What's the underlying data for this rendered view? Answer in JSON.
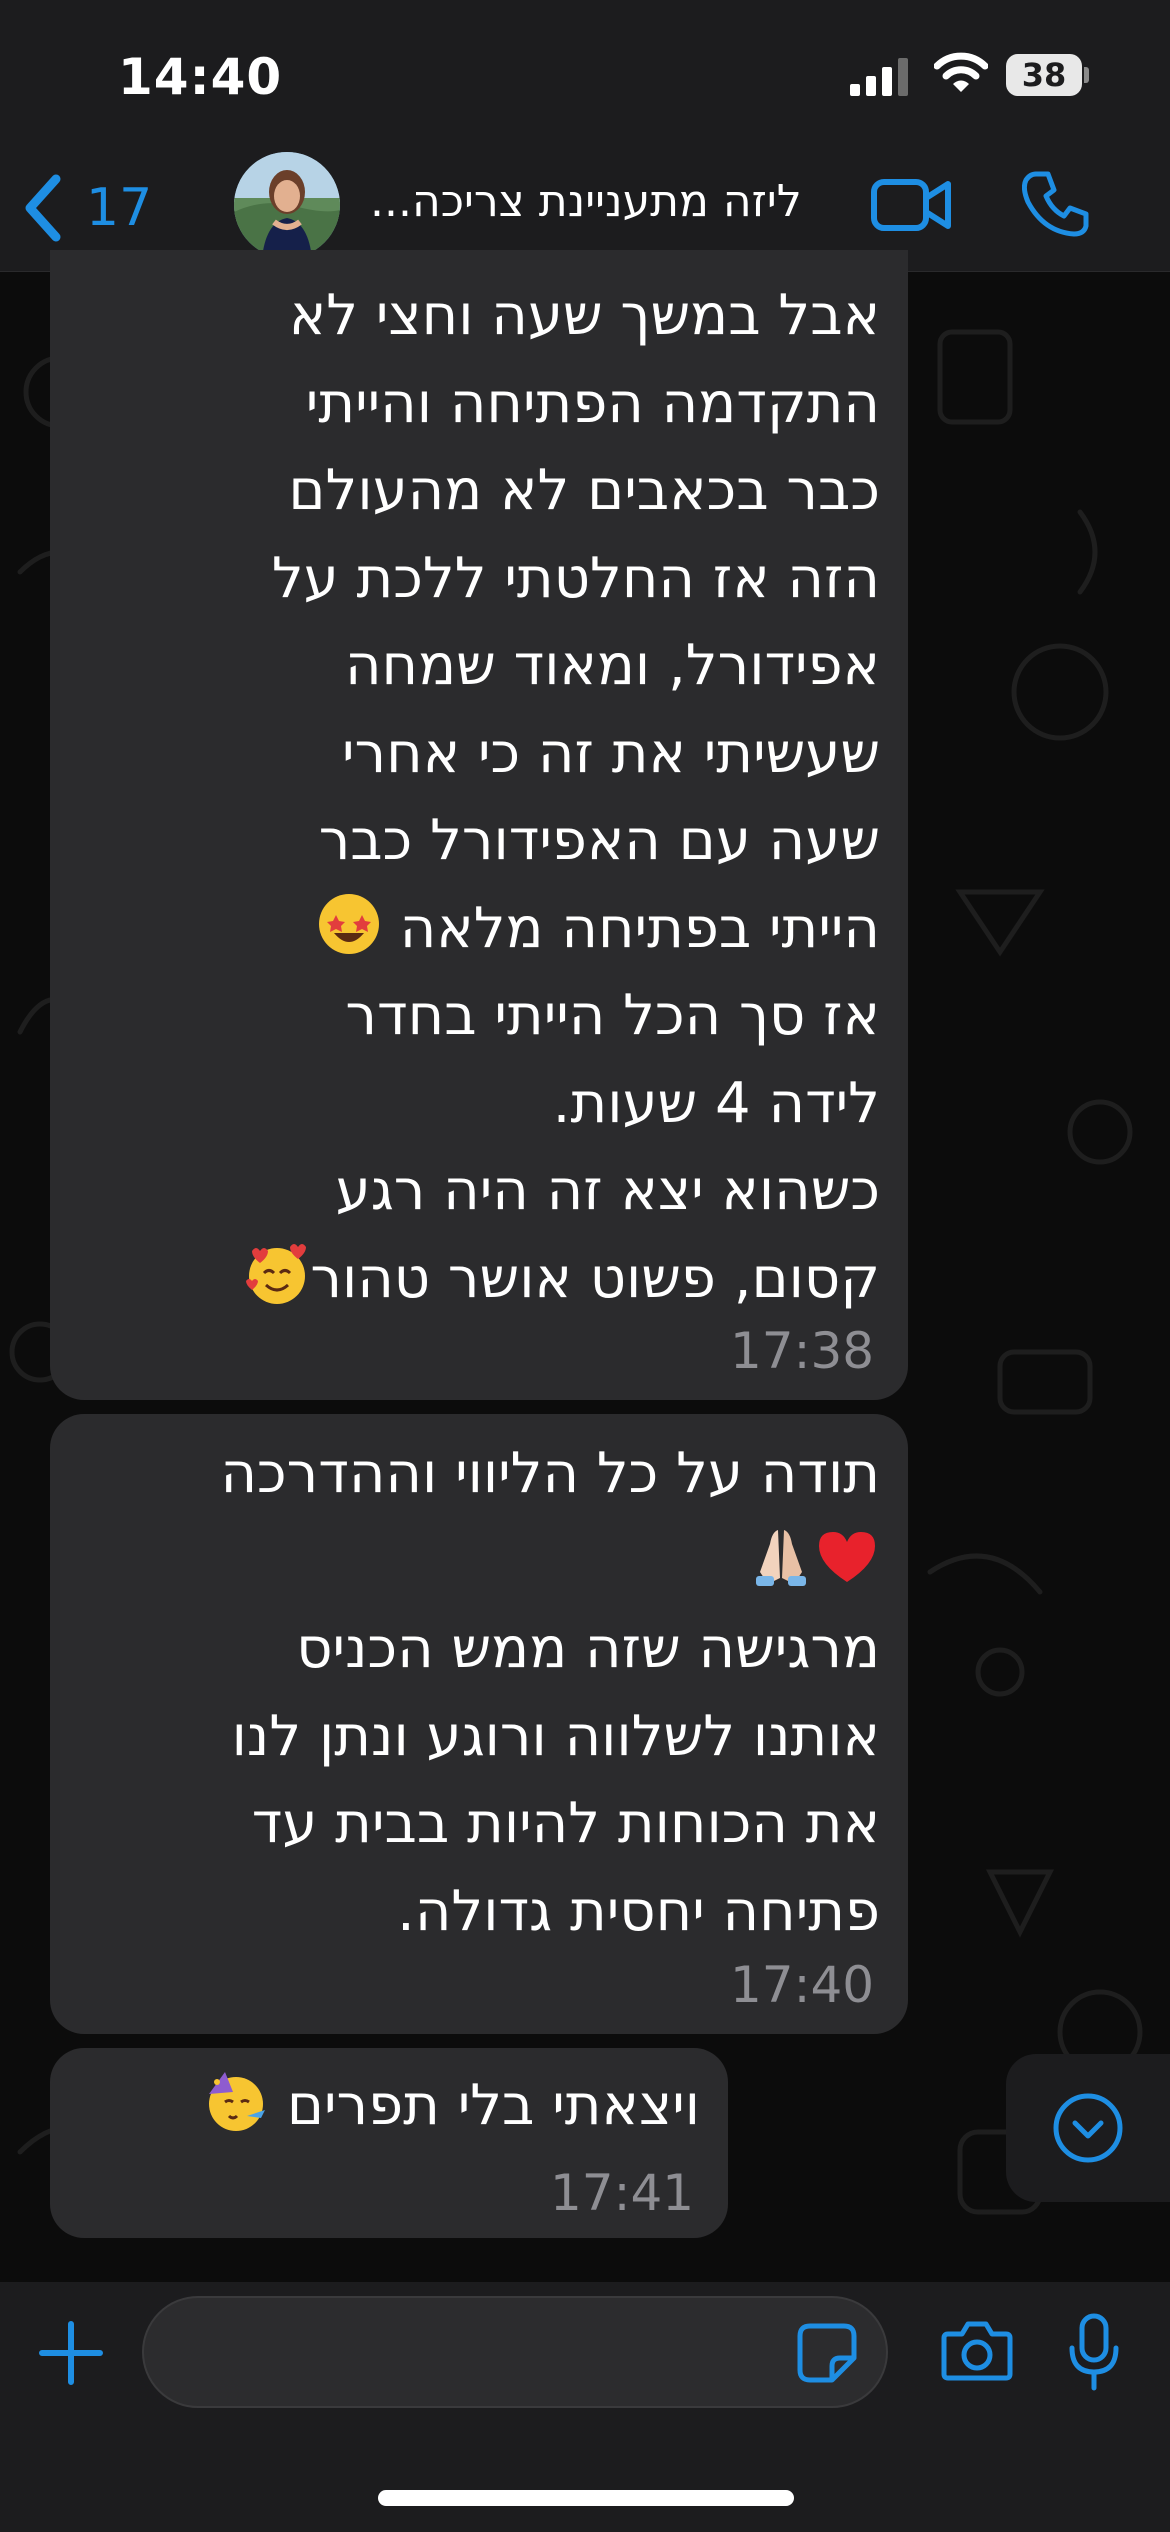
{
  "status_bar": {
    "time": "14:40",
    "battery": "38"
  },
  "header": {
    "back_count": "17",
    "contact_name": "ליזה מתעניינת צריכה...",
    "contact_name_display": "ליזה מתעניינת צריכה..."
  },
  "messages": [
    {
      "text": "אבל במשך שעה וחצי לא\nהתקדמה הפתיחה והייתי\nכבר בכאבים לא מהעולם\nהזה אז החלטתי ללכת על\nאפידורל, ומאוד שמחה\nשעשיתי את זה כי אחרי\nשעה עם האפידורל כבר\nהייתי בפתיחה מלאה",
      "text_b": "אז סך הכל הייתי בחדר\nלידה 4 שעות.\nכשהוא יצא זה היה רגע\nקסום, פשוט אושר טהור",
      "time": "17:38",
      "emojis": [
        "star-struck-emoji",
        "smiling-face-with-hearts-emoji"
      ]
    },
    {
      "text": "תודה על כל הליווי וההדרכה",
      "text_b": "מרגישה שזה ממש הכניס\nאותנו לשלווה ורוגע ונתן לנו\nאת הכוחות להיות בבית עד\nפתיחה יחסית גדולה.",
      "time": "17:40",
      "emojis": [
        "red-heart-emoji",
        "folded-hands-emoji"
      ]
    },
    {
      "text": "ויצאתי בלי תפרים",
      "time": "17:41",
      "emojis": [
        "partying-face-emoji"
      ]
    }
  ],
  "composer": {
    "placeholder": ""
  },
  "icons": [
    "signal-icon",
    "wifi-icon",
    "battery-icon",
    "back-chevron-icon",
    "video-camera-icon",
    "phone-icon",
    "chevron-down-circle-icon",
    "plus-icon",
    "sticker-icon",
    "camera-icon",
    "microphone-icon"
  ],
  "colors": {
    "accent": "#1e8ee3",
    "bubble": "#2b2b2d",
    "background": "#0c0c0c",
    "bar": "#1c1c1e",
    "timestamp": "#8e8e93"
  }
}
